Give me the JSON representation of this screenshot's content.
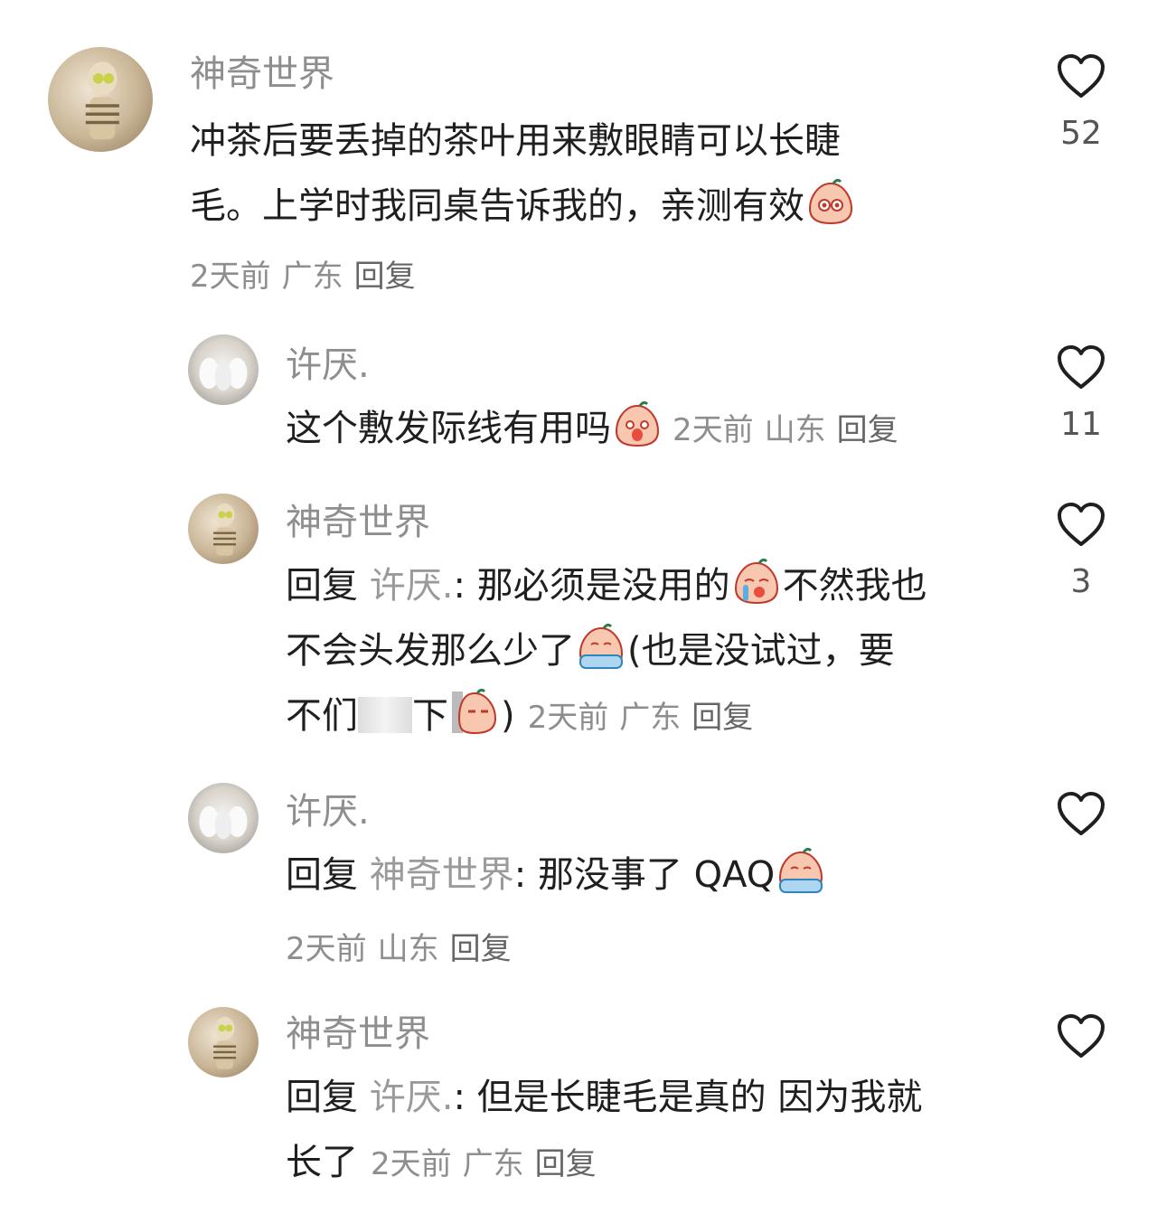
{
  "comments": [
    {
      "user": "神奇世界",
      "text_line1": "冲茶后要丢掉的茶叶用来敷眼睛可以长睫",
      "text_line2": "毛。上学时我同桌告诉我的，亲测有效",
      "time": "2天前",
      "location": "广东",
      "reply": "回复",
      "likes": "52"
    },
    {
      "user": "许厌.",
      "text": "这个敷发际线有用吗",
      "time": "2天前",
      "location": "山东",
      "reply": "回复",
      "likes": "11"
    },
    {
      "user": "神奇世界",
      "reply_prefix": "回复",
      "reply_to": "许厌.",
      "text_a": ": 那必须是没用的",
      "text_b": "不然我也",
      "text_c": "不会头发那么少了",
      "text_d": "(也是没试过，要",
      "text_e": "不们",
      "text_f": "下",
      "text_g": ")",
      "time": "2天前",
      "location": "广东",
      "reply": "回复",
      "likes": "3"
    },
    {
      "user": "许厌.",
      "reply_prefix": "回复",
      "reply_to": "神奇世界",
      "text": ": 那没事了 QAQ",
      "time": "2天前",
      "location": "山东",
      "reply": "回复",
      "likes": ""
    },
    {
      "user": "神奇世界",
      "reply_prefix": "回复",
      "reply_to": "许厌.",
      "text_a": ": 但是长睫毛是真的 因为我就",
      "text_b": "长了",
      "time": "2天前",
      "location": "广东",
      "reply": "回复",
      "likes": ""
    }
  ],
  "icons": {
    "like": "heart-outline-icon",
    "emoji_face": "peach-face-emoji"
  },
  "colors": {
    "text": "#1f1f1f",
    "meta": "#8e8e8e",
    "heart": "#1f1f1f"
  }
}
